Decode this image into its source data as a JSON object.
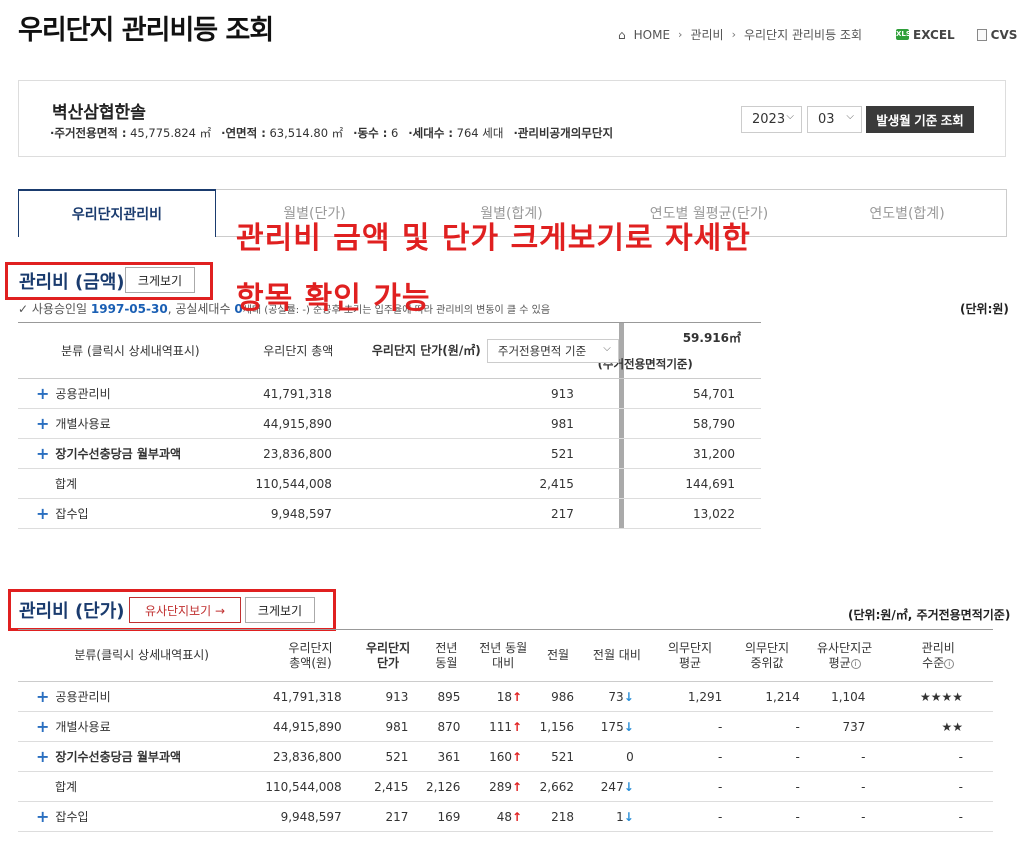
{
  "page": {
    "title": "우리단지 관리비등 조회"
  },
  "breadcrumb": {
    "home": "HOME",
    "level1": "관리비",
    "level2": "우리단지 관리비등 조회",
    "excel": "EXCEL",
    "cvs": "CVS"
  },
  "complex": {
    "name": "벽산삼협한솔",
    "area_label": "·주거전용면적 :",
    "area_value": "45,775.824 ㎡",
    "floor_label": "·연면적 :",
    "floor_value": "63,514.80 ㎡",
    "dong_label": "·동수 :",
    "dong_value": "6",
    "hh_label": "·세대수 :",
    "hh_value": "764 세대",
    "disclosure": "·관리비공개의무단지"
  },
  "controls": {
    "year": "2023",
    "month": "03",
    "query_button": "발생월 기준 조회"
  },
  "tabs": [
    "우리단지관리비",
    "월별(단가)",
    "월별(합계)",
    "연도별 월평균(단가)",
    "연도별(합계)"
  ],
  "overlay": {
    "line1": "관리비 금액 및 단가 크게보기로 자세한",
    "line2": "항목 확인 가능"
  },
  "section1": {
    "title": "관리비 (금액)",
    "zoom_button": "크게보기",
    "note_prefix": "사용승인일",
    "approval_date": "1997-05-30",
    "note_mid": ", 공실세대수",
    "vacant": "0",
    "note_suffix": "세대 (공실률: -) 준공후 초기는 입주율에 따라 관리비의 변동이 클 수 있음",
    "unit": "(단위:원)",
    "area_value": "59.916㎡",
    "area_caption": "(주거전용면적기준)",
    "headers": {
      "category": "분류 (클릭시 상세내역표시)",
      "total": "우리단지 총액",
      "unit_price": "우리단지 단가(원/㎡)",
      "basis": "주거전용면적 기준"
    },
    "rows": [
      {
        "name": "공용관리비",
        "total": "41,791,318",
        "unit": "913",
        "area": "54,701",
        "plus": true,
        "bold": false
      },
      {
        "name": "개별사용료",
        "total": "44,915,890",
        "unit": "981",
        "area": "58,790",
        "plus": true,
        "bold": false
      },
      {
        "name": "장기수선충당금 월부과액",
        "total": "23,836,800",
        "unit": "521",
        "area": "31,200",
        "plus": true,
        "bold": true
      },
      {
        "name": "합계",
        "total": "110,544,008",
        "unit": "2,415",
        "area": "144,691",
        "plus": false,
        "bold": false
      },
      {
        "name": "잡수입",
        "total": "9,948,597",
        "unit": "217",
        "area": "13,022",
        "plus": true,
        "bold": false
      }
    ]
  },
  "section2": {
    "title": "관리비 (단가)",
    "similar_button": "유사단지보기 →",
    "zoom_button": "크게보기",
    "unit": "(단위:원/㎡, 주거전용면적기준)",
    "headers": {
      "category": "분류(클릭시 상세내역표시)",
      "total": "우리단지|총액(원)",
      "unit": "우리단지|단가",
      "prev_year": "전년|동월",
      "yoy": "전년 동월|대비",
      "prev_month": "전월",
      "mom": "전월 대비",
      "mand_avg": "의무단지|평균",
      "mand_median": "의무단지|중위값",
      "similar_avg": "유사단지군|평균",
      "level": "관리비|수준"
    },
    "rows": [
      {
        "name": "공용관리비",
        "total": "41,791,318",
        "unit": "913",
        "prev_year": "895",
        "yoy": "18",
        "yoy_dir": "up",
        "prev_month": "986",
        "mom": "73",
        "mom_dir": "down",
        "mand_avg": "1,291",
        "mand_median": "1,214",
        "similar_avg": "1,104",
        "level": "★★★★",
        "plus": true,
        "bold": false
      },
      {
        "name": "개별사용료",
        "total": "44,915,890",
        "unit": "981",
        "prev_year": "870",
        "yoy": "111",
        "yoy_dir": "up",
        "prev_month": "1,156",
        "mom": "175",
        "mom_dir": "down",
        "mand_avg": "-",
        "mand_median": "-",
        "similar_avg": "737",
        "level": "★★",
        "plus": true,
        "bold": false
      },
      {
        "name": "장기수선충당금 월부과액",
        "total": "23,836,800",
        "unit": "521",
        "prev_year": "361",
        "yoy": "160",
        "yoy_dir": "up",
        "prev_month": "521",
        "mom": "0",
        "mom_dir": "",
        "mand_avg": "-",
        "mand_median": "-",
        "similar_avg": "-",
        "level": "-",
        "plus": true,
        "bold": true
      },
      {
        "name": "합계",
        "total": "110,544,008",
        "unit": "2,415",
        "prev_year": "2,126",
        "yoy": "289",
        "yoy_dir": "up",
        "prev_month": "2,662",
        "mom": "247",
        "mom_dir": "down",
        "mand_avg": "-",
        "mand_median": "-",
        "similar_avg": "-",
        "level": "-",
        "plus": false,
        "bold": false
      },
      {
        "name": "잡수입",
        "total": "9,948,597",
        "unit": "217",
        "prev_year": "169",
        "yoy": "48",
        "yoy_dir": "up",
        "prev_month": "218",
        "mom": "1",
        "mom_dir": "down",
        "mand_avg": "-",
        "mand_median": "-",
        "similar_avg": "-",
        "level": "-",
        "plus": true,
        "bold": false
      }
    ]
  }
}
